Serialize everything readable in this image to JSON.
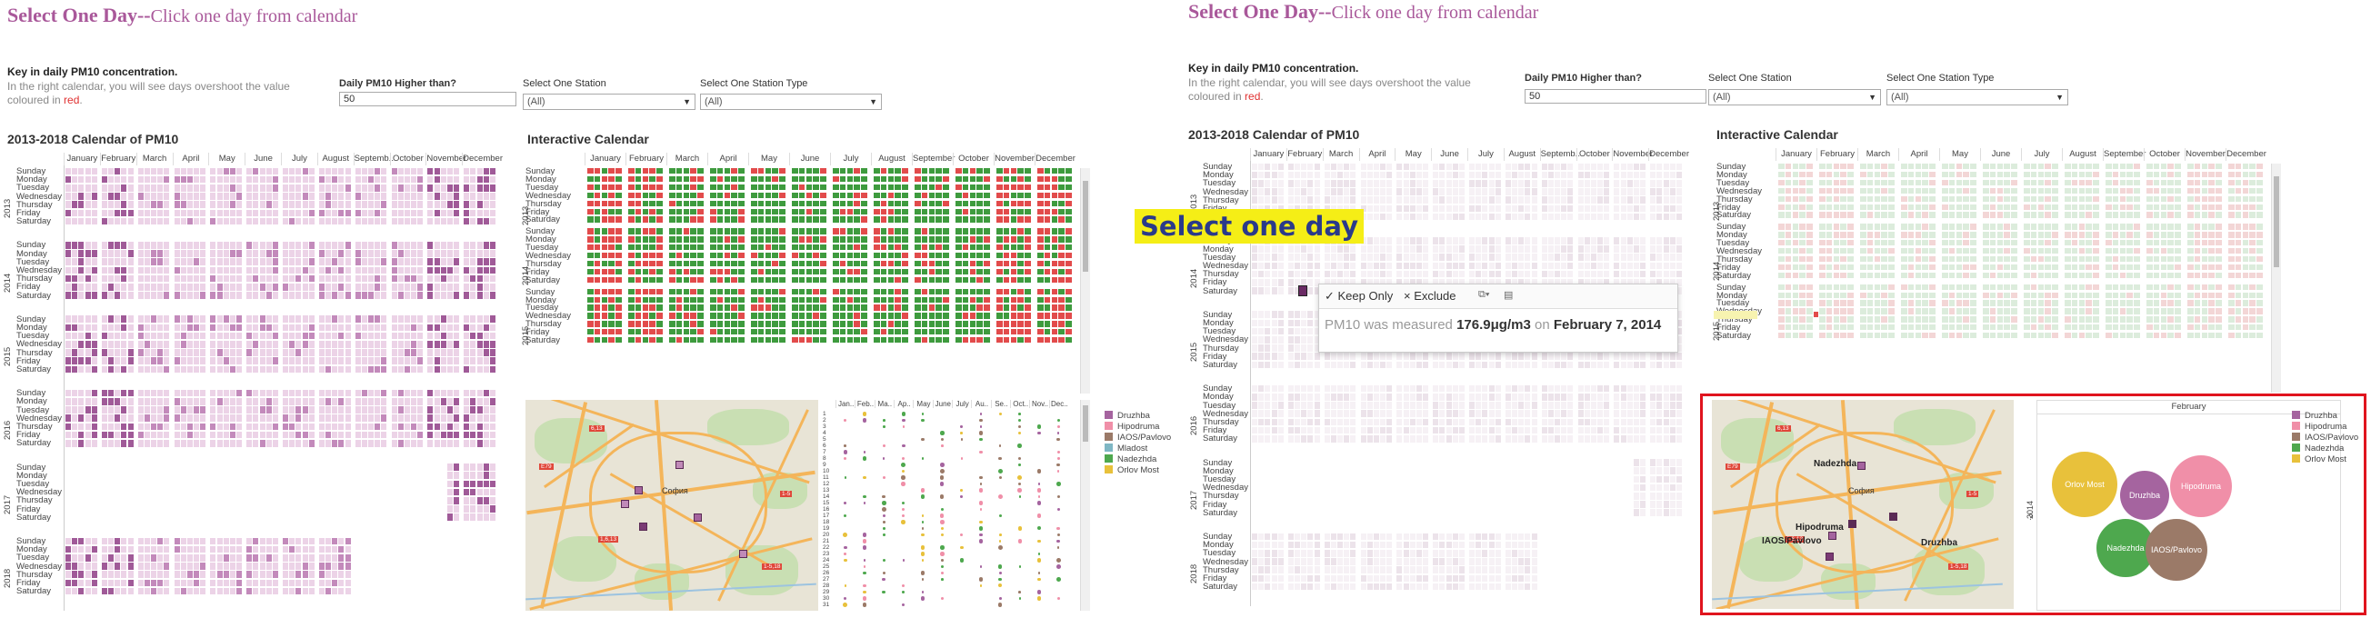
{
  "header": {
    "title_main": "Select One Day--",
    "title_sub": "Click one day from calendar"
  },
  "key": {
    "heading": "Key in daily PM10 concentration.",
    "line1": "In the right calendar, you will see days overshoot the value",
    "line2_pre": "coloured in ",
    "line2_red": "red",
    "line2_post": "."
  },
  "filters": {
    "threshold_label": "Daily PM10 Higher than?",
    "threshold_value": "50",
    "station_label": "Select One Station",
    "station_value": "(All)",
    "station_type_label": "Select One Station Type",
    "station_type_value": "(All)"
  },
  "calendar": {
    "title": "2013-2018 Calendar of PM10",
    "months": [
      "January",
      "February",
      "March",
      "April",
      "May",
      "June",
      "July",
      "August",
      "Septemb..",
      "October",
      "November",
      "December"
    ],
    "days": [
      "Sunday",
      "Monday",
      "Tuesday",
      "Wednesday",
      "Thursday",
      "Friday",
      "Saturday"
    ],
    "years": [
      "2013",
      "2014",
      "2015",
      "2016",
      "2017",
      "2018"
    ]
  },
  "interactive": {
    "title": "Interactive Calendar",
    "months": [
      "January",
      "February",
      "March",
      "April",
      "May",
      "June",
      "July",
      "August",
      "September",
      "October",
      "November",
      "December"
    ],
    "days": [
      "Sunday",
      "Monday",
      "Tuesday",
      "Wednesday",
      "Thursday",
      "Friday",
      "Saturday"
    ],
    "years": [
      "2013",
      "2014",
      "2015"
    ],
    "colors": {
      "over": "#e24b4b",
      "under": "#3e9b3e"
    }
  },
  "small_months": [
    "Jan..",
    "Feb..",
    "Ma..",
    "Ap..",
    "May",
    "June",
    "July",
    "Au..",
    "Se..",
    "Oct..",
    "Nov..",
    "Dec.."
  ],
  "small_days": [
    "1",
    "2",
    "3",
    "4",
    "5",
    "6",
    "7",
    "8",
    "9",
    "10",
    "11",
    "12",
    "13",
    "14",
    "15",
    "16",
    "17",
    "18",
    "19",
    "20",
    "21",
    "22",
    "23",
    "24",
    "25",
    "26",
    "27",
    "28",
    "29",
    "30",
    "31"
  ],
  "legend": [
    {
      "name": "Druzhba",
      "color": "#a5649f"
    },
    {
      "name": "Hipodruma",
      "color": "#f08fa8"
    },
    {
      "name": "IAOS/Pavlovo",
      "color": "#9b7a68"
    },
    {
      "name": "Mladost",
      "color": "#7fb7c4"
    },
    {
      "name": "Nadezhda",
      "color": "#4ea84e"
    },
    {
      "name": "Orlov Most",
      "color": "#e8c13b"
    }
  ],
  "legend_right": [
    {
      "name": "Druzhba",
      "color": "#a5649f"
    },
    {
      "name": "Hipodruma",
      "color": "#f08fa8"
    },
    {
      "name": "IAOS/Pavlovo",
      "color": "#9b7a68"
    },
    {
      "name": "Nadezhda",
      "color": "#4ea84e"
    },
    {
      "name": "Orlov Most",
      "color": "#e8c13b"
    }
  ],
  "map": {
    "city": "София",
    "labels_right": {
      "nadezhda": "Nadezhda",
      "hipodruma": "Hipodruma",
      "iaos": "IAOS/Pavlovo",
      "druzhba": "Druzhba"
    },
    "road_tags": [
      "6,13",
      "E79",
      "1-5",
      "1,6,13",
      "1-5,18"
    ]
  },
  "bubbles": {
    "month": "February",
    "year": "2014",
    "axis": "?",
    "items": [
      {
        "name": "Orlov Most",
        "color": "#e8c13b",
        "value": 1.0
      },
      {
        "name": "Druzhba",
        "color": "#a5649f",
        "value": 0.75
      },
      {
        "name": "Hipodruma",
        "color": "#f08fa8",
        "value": 0.95
      },
      {
        "name": "Nadezhda",
        "color": "#4ea84e",
        "value": 0.9
      },
      {
        "name": "IAOS/Pavlovo",
        "color": "#9b7a68",
        "value": 0.95
      }
    ]
  },
  "overlay": {
    "select_banner": "Select one day"
  },
  "tooltip": {
    "keep": "✓ Keep Only",
    "exclude": "× Exclude",
    "text_pre": "PM10 was measured ",
    "value": "176.9μg/m3",
    "text_mid": " on ",
    "date": "February 7, 2014"
  }
}
